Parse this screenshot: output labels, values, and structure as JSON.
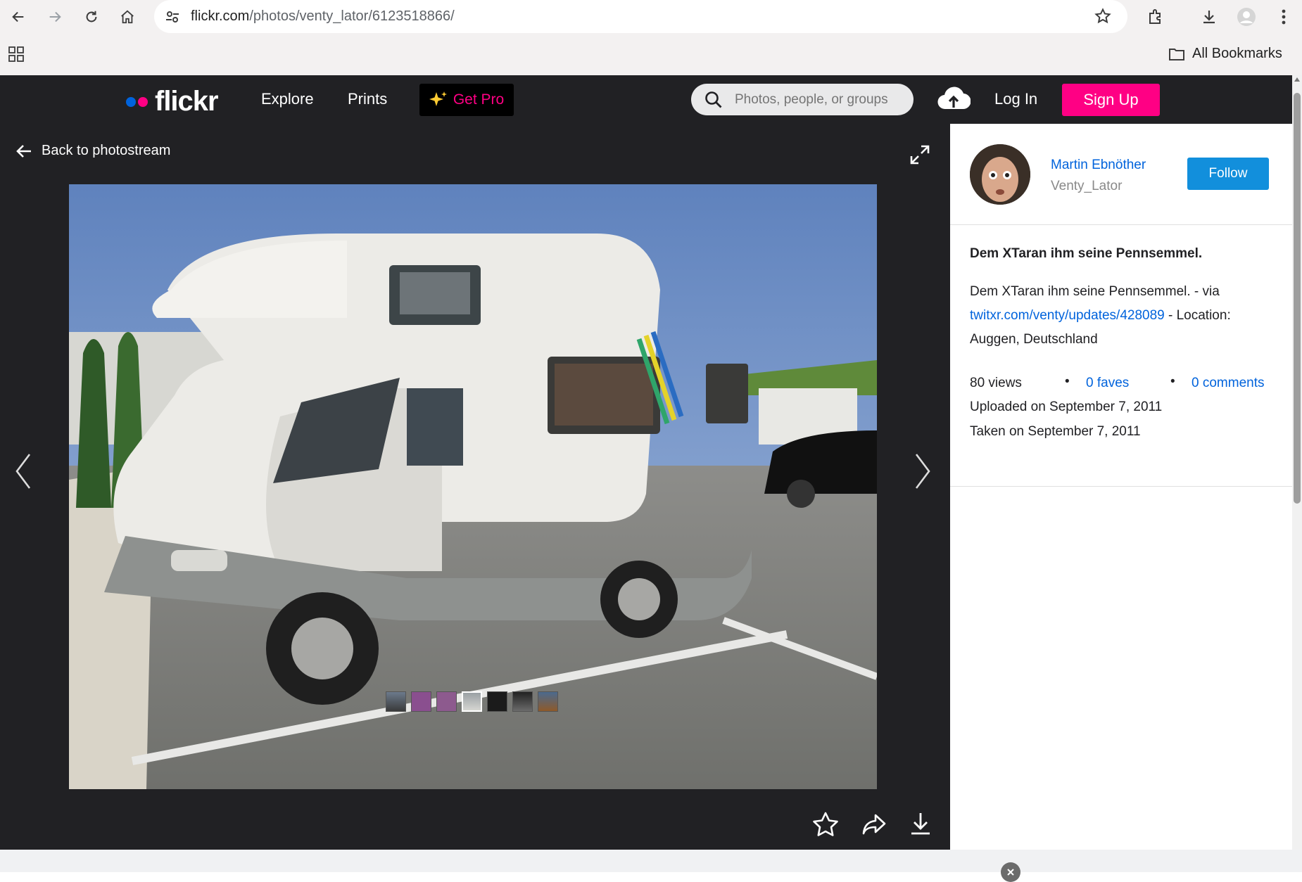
{
  "browser": {
    "url_host": "flickr.com",
    "url_path": "/photos/venty_lator/6123518866/",
    "bookmarks_label": "All Bookmarks"
  },
  "header": {
    "logo_text": "flickr",
    "nav": [
      "Explore",
      "Prints"
    ],
    "get_pro_label": "Get Pro",
    "search_placeholder": "Photos, people, or groups",
    "login_label": "Log In",
    "signup_label": "Sign Up"
  },
  "stage": {
    "back_label": "Back to photostream",
    "thumbnail_count": 7
  },
  "sidebar": {
    "author_name": "Martin Ebnöther",
    "author_handle": "Venty_Lator",
    "follow_label": "Follow",
    "title": "Dem XTaran ihm seine Pennsemmel.",
    "description_text": "Dem XTaran ihm seine Pennsemmel. - via",
    "description_link": "twitxr.com/venty/updates/428089",
    "description_location": " - Location: Auggen, Deutschland",
    "stats": {
      "views": "80 views",
      "faves": "0 faves",
      "comments": "0 comments"
    },
    "uploaded": "Uploaded on September 7, 2011",
    "taken": "Taken on September 7, 2011"
  },
  "colors": {
    "flickr_pink": "#ff0084",
    "flickr_blue": "#0063dc",
    "follow_blue": "#128fdc",
    "dark_bg": "#212124"
  }
}
